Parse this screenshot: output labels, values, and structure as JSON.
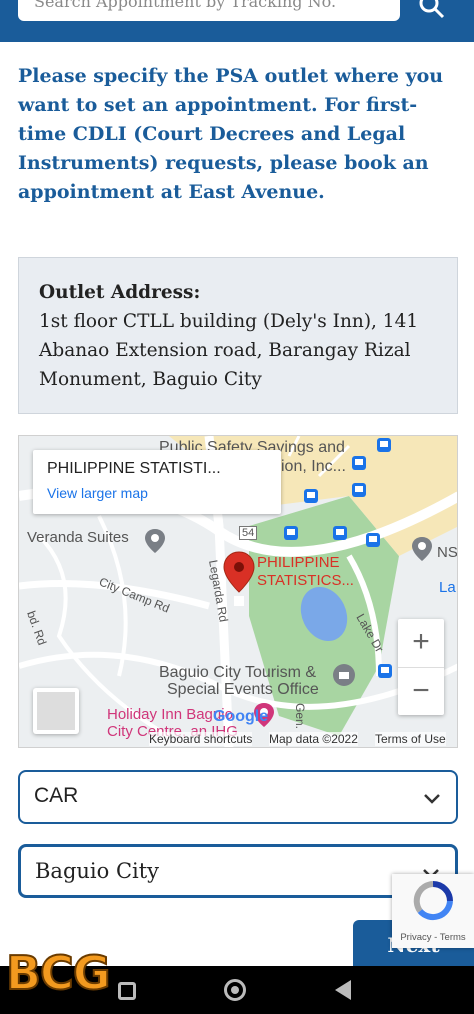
{
  "search": {
    "placeholder": "Search Appointment by Tracking No."
  },
  "intro_text": "Please specify the PSA outlet where you want to set an appointment. For first-time CDLI (Court Decrees and Legal Instruments) requests, please book an appointment at East Avenue.",
  "outlet": {
    "label": "Outlet Address:",
    "address": "1st floor CTLL building (Dely's Inn), 141 Abanao Extension road, Barangay Rizal Monument, Baguio City"
  },
  "map": {
    "place_title": "PHILIPPINE STATISTI...",
    "view_larger": "View larger map",
    "pin_label_1": "PHILIPPINE",
    "pin_label_2": "STATISTICS...",
    "labels": {
      "public_safety": "Public Safety Savings and",
      "ion_inc": "ion, Inc...",
      "veranda": "Veranda Suites",
      "city_camp": "City Camp Rd",
      "legarda": "Legarda Rd",
      "lake_dr": "Lake Dr",
      "tourism_1": "Baguio City Tourism &",
      "tourism_2": "Special Events Office",
      "holiday_1": "Holiday Inn Baguio",
      "holiday_2": "City Centre, an IHG",
      "ns": "NS",
      "la": "La",
      "abd_rd": "bd. Rd",
      "gen": "Gen.",
      "route54": "54"
    },
    "zoom_in": "+",
    "zoom_out": "−",
    "google": "Google",
    "keyboard": "Keyboard shortcuts",
    "mapdata": "Map data ©2022",
    "terms": "Terms of Use"
  },
  "region_select": {
    "value": "CAR"
  },
  "city_select": {
    "value": "Baguio City"
  },
  "next_label": "Next",
  "recaptcha": {
    "privacy": "Privacy",
    "terms": "Terms"
  },
  "watermark": "BCG",
  "colors": {
    "primary": "#1a5c9a",
    "pin": "#d93025",
    "park": "#a8d5a2"
  }
}
